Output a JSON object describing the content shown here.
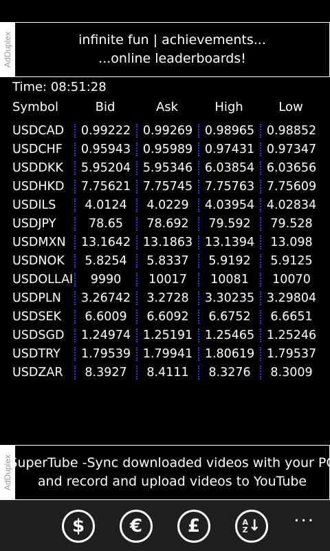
{
  "ad_top": {
    "label": "AdDuplex",
    "line1": "infinite fun | achievements...",
    "line2": "...online leaderboards!"
  },
  "time": "Time: 08:51:28",
  "headers": [
    "Symbol",
    "Bid",
    "Ask",
    "High",
    "Low"
  ],
  "rows": [
    [
      "USDCAD",
      "0.99222",
      "0.99269",
      "0.98965",
      "0.98852"
    ],
    [
      "USDCHF",
      "0.95943",
      "0.95989",
      "0.97431",
      "0.97347"
    ],
    [
      "USDDKK",
      "5.95204",
      "5.95346",
      "6.03854",
      "6.03656"
    ],
    [
      "USDHKD",
      "7.75621",
      "7.75745",
      "7.75763",
      "7.75609"
    ],
    [
      "USDILS",
      "4.0124",
      "4.0229",
      "4.03954",
      "4.02834"
    ],
    [
      "USDJPY",
      "78.65",
      "78.692",
      "79.592",
      "79.528"
    ],
    [
      "USDMXN",
      "13.1642",
      "13.1863",
      "13.1394",
      "13.098"
    ],
    [
      "USDNOK",
      "5.8254",
      "5.8337",
      "5.9192",
      "5.9125"
    ],
    [
      "USDOLLAI",
      "9990",
      "10017",
      "10081",
      "10070"
    ],
    [
      "USDPLN",
      "3.26742",
      "3.2728",
      "3.30235",
      "3.29804"
    ],
    [
      "USDSEK",
      "6.6009",
      "6.6092",
      "6.6752",
      "6.6651"
    ],
    [
      "USDSGD",
      "1.24974",
      "1.25191",
      "1.25465",
      "1.25246"
    ],
    [
      "USDTRY",
      "1.79539",
      "1.79941",
      "1.80619",
      "1.79537"
    ],
    [
      "USDZAR",
      "8.3927",
      "8.4111",
      "8.3276",
      "8.3009"
    ]
  ],
  "ad_bottom": {
    "label": "AdDuplex",
    "line1": "SuperTube -Sync downloaded videos with your PC",
    "line2": "and record and upload videos to YouTube"
  },
  "appbar": {
    "dollar": "$",
    "euro": "€",
    "pound": "£",
    "sort_top": "A",
    "sort_bottom": "Z",
    "sort_arrow": "↓",
    "more": "..."
  }
}
